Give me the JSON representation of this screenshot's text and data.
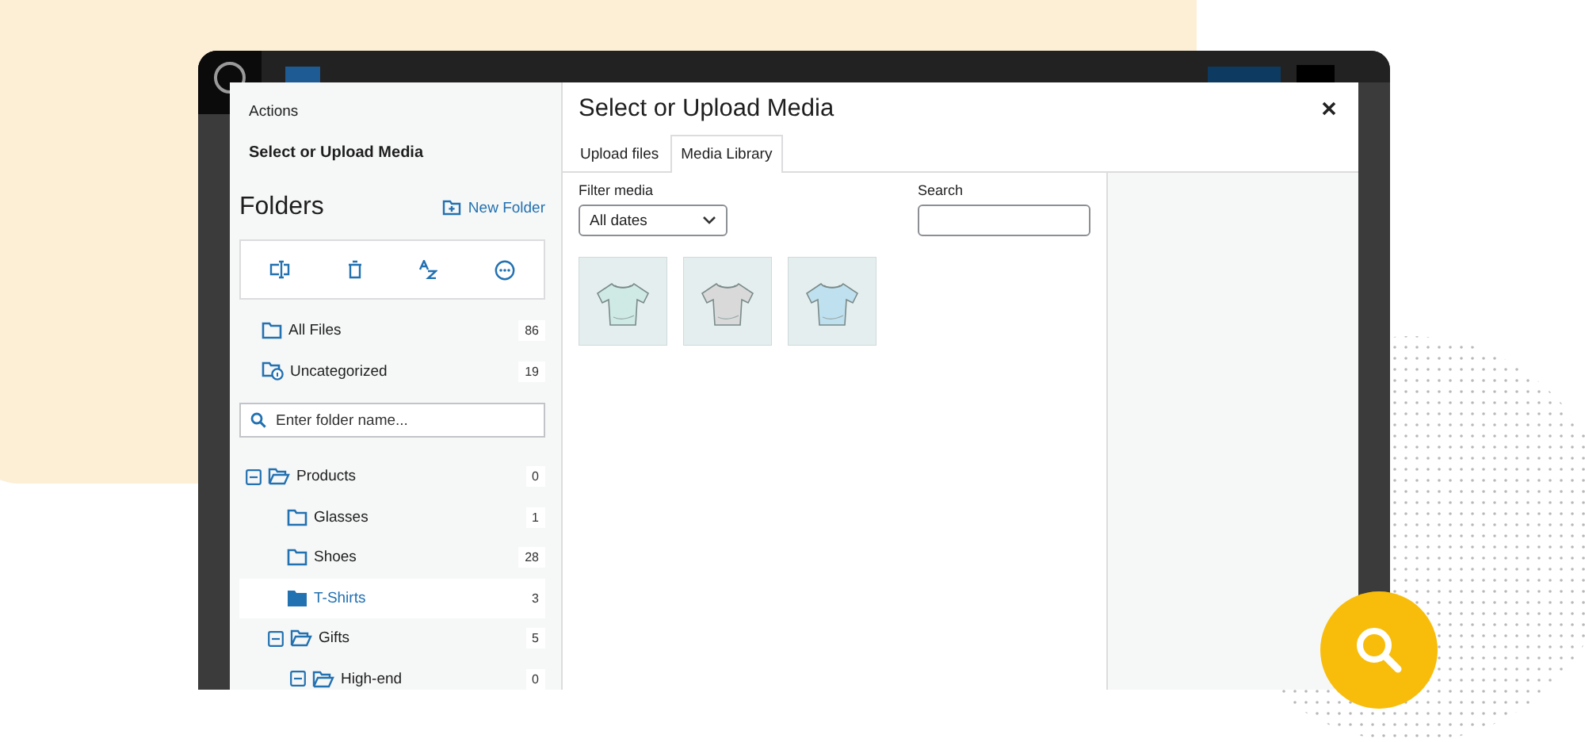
{
  "folders_panel": {
    "breadcrumb": "Actions",
    "title": "Select or Upload Media",
    "heading": "Folders",
    "new_folder": "New Folder",
    "top": [
      {
        "kind": "all",
        "label": "All Files",
        "count": "86"
      },
      {
        "kind": "uncategorized",
        "label": "Uncategorized",
        "count": "19"
      }
    ],
    "search": {
      "placeholder": "Enter folder name..."
    },
    "tree": [
      {
        "label": "Products",
        "count": "0",
        "expanded": true,
        "selected": false,
        "children": [
          {
            "label": "Glasses",
            "count": "1",
            "selected": false
          },
          {
            "label": "Shoes",
            "count": "28",
            "selected": false
          },
          {
            "label": "T-Shirts",
            "count": "3",
            "selected": true
          },
          {
            "label": "Gifts",
            "count": "5",
            "expanded": true,
            "selected": false,
            "children": [
              {
                "label": "High-end",
                "count": "0",
                "expanded": true,
                "selected": false
              }
            ]
          }
        ]
      }
    ]
  },
  "modal": {
    "title": "Select or Upload Media",
    "tabs": [
      {
        "label": "Upload files",
        "selected": false
      },
      {
        "label": "Media Library",
        "selected": true
      }
    ],
    "filter": {
      "label": "Filter media",
      "value": "All dates"
    },
    "search": {
      "label": "Search"
    }
  }
}
